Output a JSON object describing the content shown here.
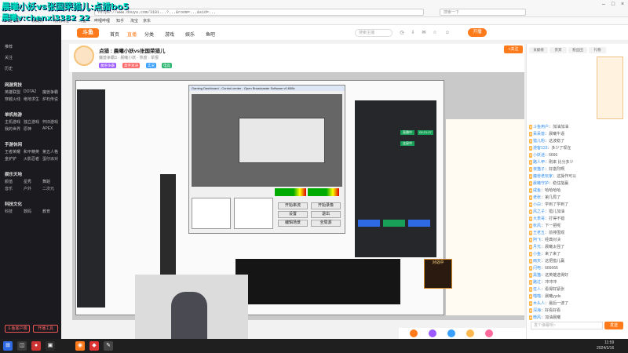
{
  "browser": {
    "url": "https://www.douyu.com/3181...?...&room=...&sid=...",
    "search_placeholder": "搜索一下"
  },
  "overlay": {
    "line1": "晨曦小妖vs张国荣猎儿:点猎bo5",
    "line2": "晨曦v:chenxi3382 22"
  },
  "bookmarks": [
    "网址导航",
    "收藏夹",
    "常用网址",
    "斗鱼",
    "哔哩哔哩",
    "知乎",
    "淘宝",
    "京东"
  ],
  "site": {
    "logo": "斗鱼",
    "nav": [
      "首页",
      "直播",
      "分类",
      "游戏",
      "娱乐",
      "鱼吧"
    ],
    "search_placeholder": "搜索主播",
    "open_live": "开播",
    "side": {
      "top_items": [
        "推荐",
        "关注",
        "历史"
      ],
      "sections": [
        {
          "title": "网游竞技",
          "items": [
            "英雄联盟",
            "DOTA2",
            "魔兽争霸",
            "穿越火线",
            "绝地求生",
            "炉石传说"
          ]
        },
        {
          "title": "单机热游",
          "items": [
            "主机游戏",
            "独立游戏",
            "怀旧游戏",
            "我的世界",
            "原神",
            "APEX"
          ]
        },
        {
          "title": "手游休闲",
          "items": [
            "王者荣耀",
            "和平精英",
            "第五人格",
            "金铲铲",
            "火影忍者",
            "蛋仔派对"
          ]
        },
        {
          "title": "娱乐天地",
          "items": [
            "颜值",
            "星秀",
            "舞蹈",
            "音乐",
            "户外",
            "二次元"
          ]
        },
        {
          "title": "科技文化",
          "items": [
            "科技",
            "数码",
            "教育"
          ]
        }
      ],
      "btn_left": "斗鱼客户端",
      "btn_right": "开播工具"
    }
  },
  "room": {
    "title": "点猎 : 晨曦小妖vs张国荣猎儿",
    "meta": "魔兽争霸3 · 晨曦小妖 · 热度 · 举报",
    "tags": [
      "魔兽争霸",
      "高手对决",
      "实况",
      "电竞"
    ],
    "follow": "+关注"
  },
  "video": {
    "obs_title": "Gaming Dashboard - Control center - Open Broadcaster Software v0.659b",
    "scene_buttons": [
      "开始串流",
      "开始录像",
      "设置",
      "退出",
      "编辑场景",
      "全局源"
    ],
    "green_labels": [
      "直播中",
      "连接中",
      "00:21:07"
    ],
    "webcam_label": "",
    "game_label": "对战中"
  },
  "chat": {
    "tabs": [
      "贡献榜",
      "贵宾",
      "粉丝团",
      "礼物"
    ],
    "messages": [
      {
        "user": "斗鱼用户",
        "text": "加油加油"
      },
      {
        "user": "呆呆兽",
        "text": "晨曦牛逼"
      },
      {
        "user": "猎儿粉",
        "text": "这波稳了"
      },
      {
        "user": "游客123",
        "text": "多少了现在"
      },
      {
        "user": "小妖迷",
        "text": "6666"
      },
      {
        "user": "路人甲",
        "text": "刚来 比分多少"
      },
      {
        "user": "夜猫子",
        "text": "好激烈啊"
      },
      {
        "user": "魔兽老玩家",
        "text": "这操作可以"
      },
      {
        "user": "晨曦守护",
        "text": "稳住能赢"
      },
      {
        "user": "咸鱼",
        "text": "哈哈哈哈"
      },
      {
        "user": "老张",
        "text": "第几局了"
      },
      {
        "user": "小白",
        "text": "学到了学到了"
      },
      {
        "user": "风之子",
        "text": "猎儿加油"
      },
      {
        "user": "大表哥",
        "text": "打得不错"
      },
      {
        "user": "秋风",
        "text": "下一把呢"
      },
      {
        "user": "王老五",
        "text": "前排围观"
      },
      {
        "user": "阿飞",
        "text": "经典对决"
      },
      {
        "user": "月光",
        "text": "晨曦太强了"
      },
      {
        "user": "小鱼",
        "text": "来了来了"
      },
      {
        "user": "雨天",
        "text": "这把猎儿赢"
      },
      {
        "user": "闪电",
        "text": "666666"
      },
      {
        "user": "黑猫",
        "text": "这英雄选得好"
      },
      {
        "user": "路过",
        "text": "冲冲冲"
      },
      {
        "user": "狂人",
        "text": "看得好紧张"
      },
      {
        "user": "喵喵",
        "text": "晨曦yyds"
      },
      {
        "user": "木头人",
        "text": "最后一波了"
      },
      {
        "user": "深海",
        "text": "好看好看"
      },
      {
        "user": "微风",
        "text": "加油晨曦"
      }
    ],
    "input_placeholder": "发个弹幕呗~",
    "send": "发送"
  },
  "taskbar": {
    "time": "11:59",
    "date": "2024/1/16"
  },
  "colors": {
    "accent": "#ff7a1a",
    "overlay": "#00e0c0",
    "nav_bg": "#1b1b1f"
  }
}
